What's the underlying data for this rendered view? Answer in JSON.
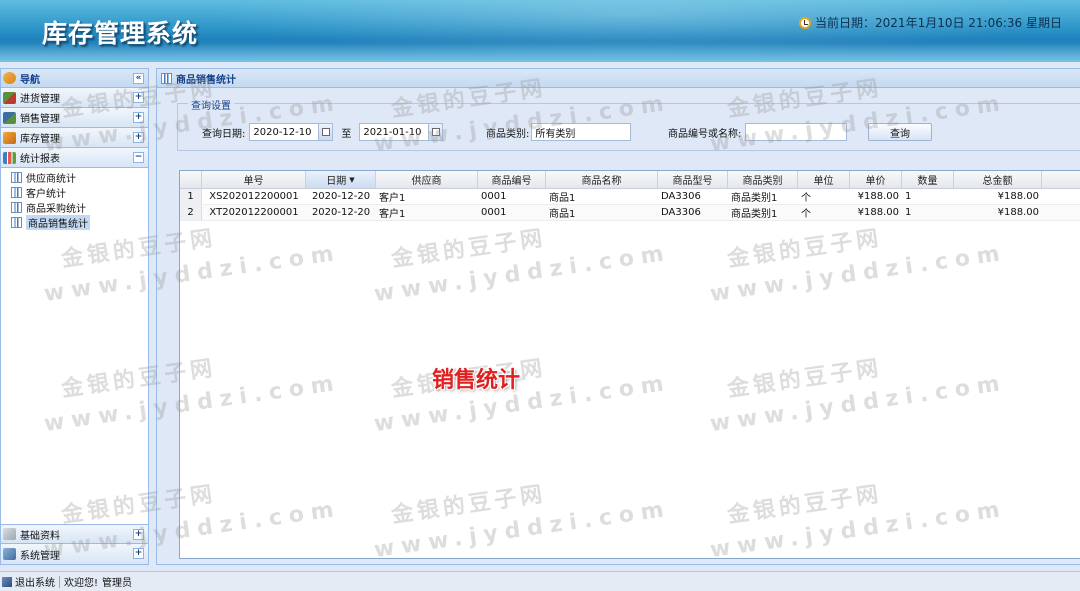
{
  "header": {
    "app_title": "库存管理系统",
    "date_label": "当前日期：",
    "date_value": "2021年1月10日 21:06:36 星期日"
  },
  "nav": {
    "title": "导航",
    "sections": [
      {
        "label": "进货管理",
        "icon": "purchase-icon",
        "expanded": false
      },
      {
        "label": "销售管理",
        "icon": "sales-icon",
        "expanded": false
      },
      {
        "label": "库存管理",
        "icon": "stock-icon",
        "expanded": false
      },
      {
        "label": "统计报表",
        "icon": "report-icon",
        "expanded": true
      }
    ],
    "report_items": [
      {
        "label": "供应商统计"
      },
      {
        "label": "客户统计"
      },
      {
        "label": "商品采购统计"
      },
      {
        "label": "商品销售统计",
        "active": true
      }
    ],
    "bottom_sections": [
      {
        "label": "基础资料",
        "icon": "database-icon"
      },
      {
        "label": "系统管理",
        "icon": "system-icon"
      }
    ]
  },
  "main": {
    "tab_title": "商品销售统计",
    "query": {
      "legend": "查询设置",
      "date_label": "查询日期:",
      "date_from": "2020-12-10",
      "to_label": "至",
      "date_to": "2021-01-10",
      "category_label": "商品类别:",
      "category_value": "所有类别",
      "code_name_label": "商品编号或名称:",
      "code_name_value": "",
      "search_button": "查询"
    },
    "grid": {
      "columns": [
        "单号",
        "日期",
        "供应商",
        "商品编号",
        "商品名称",
        "商品型号",
        "商品类别",
        "单位",
        "单价",
        "数量",
        "总金额"
      ],
      "rows": [
        {
          "index": "1",
          "order_no": "XS202012200001",
          "date": "2020-12-20",
          "party": "客户1",
          "code": "0001",
          "name": "商品1",
          "model": "DA3306",
          "category": "商品类别1",
          "unit": "个",
          "price": "¥188.00",
          "qty": "1",
          "total": "¥188.00"
        },
        {
          "index": "2",
          "order_no": "XT202012200001",
          "date": "2020-12-20",
          "party": "客户1",
          "code": "0001",
          "name": "商品1",
          "model": "DA3306",
          "category": "商品类别1",
          "unit": "个",
          "price": "¥188.00",
          "qty": "1",
          "total": "¥188.00"
        }
      ]
    },
    "overlay_label": "销售统计"
  },
  "watermark": {
    "cn": "金银的豆子网",
    "en": "www.jyddzi.com"
  },
  "status_bar": {
    "exit": "退出系统",
    "welcome": "欢迎您!",
    "user": "管理员"
  }
}
